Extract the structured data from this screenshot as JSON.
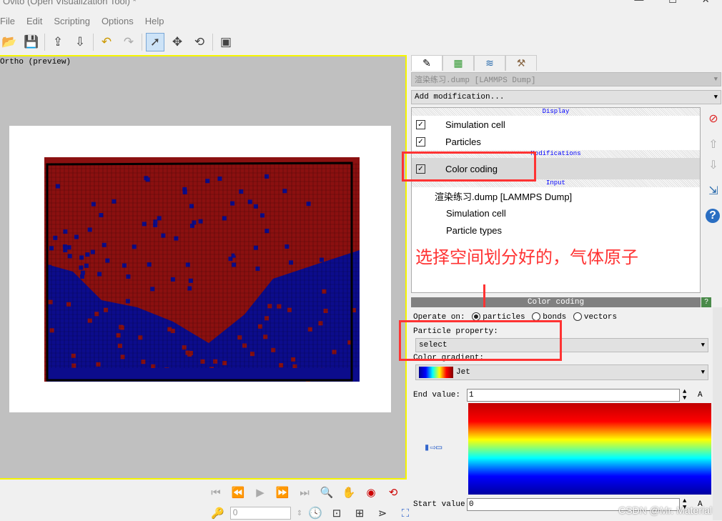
{
  "window": {
    "title": "Ovito (Open Visualization Tool) *",
    "controls": [
      "—",
      "☐",
      "✕"
    ]
  },
  "menu": [
    "File",
    "Edit",
    "Scripting",
    "Options",
    "Help"
  ],
  "toolbar": [
    {
      "icon": "open-file-icon",
      "glyph": "📂"
    },
    {
      "icon": "save-icon",
      "glyph": "💾"
    },
    {
      "icon": "import-icon",
      "glyph": "⇪"
    },
    {
      "icon": "export-icon",
      "glyph": "⇩"
    },
    {
      "icon": "undo-icon",
      "glyph": "↶"
    },
    {
      "icon": "redo-icon",
      "glyph": "↷"
    },
    {
      "icon": "select-icon",
      "glyph": "➚"
    },
    {
      "icon": "move-icon",
      "glyph": "✥"
    },
    {
      "icon": "rotate-icon",
      "glyph": "⟲"
    },
    {
      "icon": "render-icon",
      "glyph": "▣"
    }
  ],
  "viewport": {
    "label": "Ortho (preview)",
    "colors": {
      "red": "#8b1010",
      "blue": "#0c0c8c",
      "border": "#f5f500"
    }
  },
  "animation": {
    "frame": "0",
    "buttons": [
      "⏮",
      "⏪",
      "▶",
      "⏩",
      "⏭"
    ],
    "nav": [
      "🔍",
      "✋",
      "◉",
      "⟲"
    ],
    "nav2": [
      "⊡",
      "⊞",
      "⋗",
      "⛶"
    ]
  },
  "panel": {
    "tabs": [
      "✎",
      "▦",
      "≋",
      "⚒"
    ],
    "source": "渲染练习.dump [LAMMPS Dump]",
    "add_modification": "Add modification...",
    "sections": {
      "display": "Display",
      "modifications": "Modifications",
      "input": "Input"
    },
    "display_items": [
      "Simulation cell",
      "Particles"
    ],
    "modification_items": [
      "Color coding"
    ],
    "input_items": [
      "渲染练习.dump [LAMMPS Dump]",
      "Simulation cell",
      "Particle types"
    ],
    "annotation": "选择空间划分好的，气体原子",
    "color_coding": {
      "title": "Color coding",
      "help": "?",
      "operate_on": "Operate on:",
      "options": [
        "particles",
        "bonds",
        "vectors"
      ],
      "selected": "particles",
      "property_label": "Particle property:",
      "property": "select",
      "gradient_label": "Color gradient:",
      "gradient": "Jet",
      "end_label": "End value:",
      "end_value": "1",
      "start_label": "Start value:",
      "start_value": "0",
      "unit": "A"
    }
  },
  "watermark": "CSDN @Mr. Material"
}
